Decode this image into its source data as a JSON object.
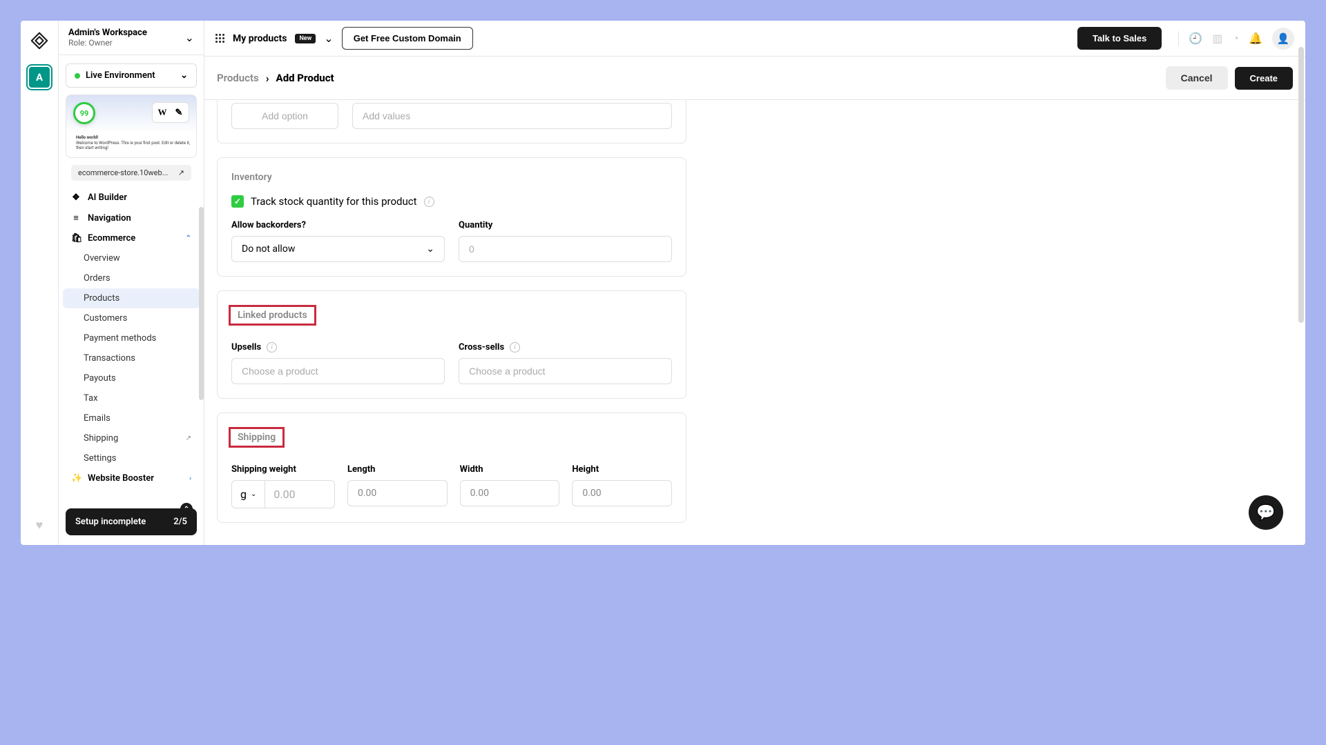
{
  "leftRail": {
    "avatarLetter": "A"
  },
  "workspace": {
    "title": "Admin's Workspace",
    "role": "Role: Owner"
  },
  "env": {
    "label": "Live Environment"
  },
  "preview": {
    "score": "99",
    "wLabel": "W",
    "heading": "Hello world!",
    "sub": "Welcome to WordPress. This is your first post. Edit or delete it, then start writing!"
  },
  "domainChip": "ecommerce-store.10web...",
  "nav": {
    "aiBuilder": "AI Builder",
    "navigation": "Navigation",
    "ecommerce": "Ecommerce",
    "overview": "Overview",
    "orders": "Orders",
    "products": "Products",
    "customers": "Customers",
    "paymentMethods": "Payment methods",
    "transactions": "Transactions",
    "payouts": "Payouts",
    "tax": "Tax",
    "emails": "Emails",
    "shipping": "Shipping",
    "settings": "Settings",
    "websiteBooster": "Website Booster"
  },
  "setup": {
    "label": "Setup incomplete",
    "progress": "2/5"
  },
  "topbar": {
    "myProducts": "My products",
    "newBadge": "New",
    "getDomain": "Get Free Custom Domain",
    "talkToSales": "Talk to Sales"
  },
  "crumbs": {
    "root": "Products",
    "current": "Add Product",
    "cancel": "Cancel",
    "create": "Create"
  },
  "options": {
    "addOptionPh": "Add option",
    "addValuesPh": "Add values"
  },
  "inventory": {
    "title": "Inventory",
    "trackLabel": "Track stock quantity for this product",
    "backordersLabel": "Allow backorders?",
    "backordersValue": "Do not allow",
    "quantityLabel": "Quantity",
    "quantityPh": "0"
  },
  "linked": {
    "title": "Linked products",
    "upsells": "Upsells",
    "crossSells": "Cross-sells",
    "choosePh": "Choose a product"
  },
  "shipping": {
    "title": "Shipping",
    "weightLabel": "Shipping weight",
    "unit": "g",
    "weightPh": "0.00",
    "length": "Length",
    "width": "Width",
    "height": "Height",
    "dimPh": "0.00"
  }
}
